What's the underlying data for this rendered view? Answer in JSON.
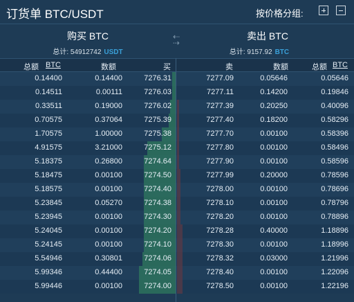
{
  "header": {
    "title": "订货单 BTC/USDT",
    "group_label": "按价格分组:",
    "plus_icon": "plus-icon",
    "minus_icon": "minus-icon"
  },
  "buy": {
    "title": "购买 BTC",
    "total_label": "总计: 54912742",
    "total_currency": "USDT"
  },
  "sell": {
    "title": "卖出 BTC",
    "total_label": "总计: 9157.92",
    "total_currency": "BTC"
  },
  "swap_icon": "swap-arrows-icon",
  "columns": {
    "total": "总额",
    "total_unit": "BTC",
    "amount": "数额",
    "buy": "买",
    "sell": "卖"
  },
  "colors": {
    "background": "#1e3b55",
    "buy_depth": "#2f7a5e",
    "sell_depth": "#5a3a45",
    "accent": "#3aa0d8"
  },
  "rows": [
    {
      "buy_total": "0.14400",
      "buy_amount": "0.14400",
      "buy_price": "7276.31",
      "sell_price": "7277.09",
      "sell_amount": "0.05646",
      "sell_total": "0.05646",
      "buy_depth": 0.02,
      "sell_depth": 0.0
    },
    {
      "buy_total": "0.14511",
      "buy_amount": "0.00111",
      "buy_price": "7276.03",
      "sell_price": "7277.11",
      "sell_amount": "0.14200",
      "sell_total": "0.19846",
      "buy_depth": 0.02,
      "sell_depth": 0.0
    },
    {
      "buy_total": "0.33511",
      "buy_amount": "0.19000",
      "buy_price": "7276.02",
      "sell_price": "7277.39",
      "sell_amount": "0.20250",
      "sell_total": "0.40096",
      "buy_depth": 0.03,
      "sell_depth": 0.01
    },
    {
      "buy_total": "0.70575",
      "buy_amount": "0.37064",
      "buy_price": "7275.39",
      "sell_price": "7277.40",
      "sell_amount": "0.18200",
      "sell_total": "0.58296",
      "buy_depth": 0.04,
      "sell_depth": 0.01
    },
    {
      "buy_total": "1.70575",
      "buy_amount": "1.00000",
      "buy_price": "7275.38",
      "sell_price": "7277.70",
      "sell_amount": "0.00100",
      "sell_total": "0.58396",
      "buy_depth": 0.08,
      "sell_depth": 0.01
    },
    {
      "buy_total": "4.91575",
      "buy_amount": "3.21000",
      "buy_price": "7275.12",
      "sell_price": "7277.80",
      "sell_amount": "0.00100",
      "sell_total": "0.58496",
      "buy_depth": 0.16,
      "sell_depth": 0.01
    },
    {
      "buy_total": "5.18375",
      "buy_amount": "0.26800",
      "buy_price": "7274.64",
      "sell_price": "7277.90",
      "sell_amount": "0.00100",
      "sell_total": "0.58596",
      "buy_depth": 0.18,
      "sell_depth": 0.01
    },
    {
      "buy_total": "5.18475",
      "buy_amount": "0.00100",
      "buy_price": "7274.50",
      "sell_price": "7277.99",
      "sell_amount": "0.20000",
      "sell_total": "0.78596",
      "buy_depth": 0.18,
      "sell_depth": 0.02
    },
    {
      "buy_total": "5.18575",
      "buy_amount": "0.00100",
      "buy_price": "7274.40",
      "sell_price": "7278.00",
      "sell_amount": "0.00100",
      "sell_total": "0.78696",
      "buy_depth": 0.18,
      "sell_depth": 0.02
    },
    {
      "buy_total": "5.23845",
      "buy_amount": "0.05270",
      "buy_price": "7274.38",
      "sell_price": "7278.10",
      "sell_amount": "0.00100",
      "sell_total": "0.78796",
      "buy_depth": 0.18,
      "sell_depth": 0.02
    },
    {
      "buy_total": "5.23945",
      "buy_amount": "0.00100",
      "buy_price": "7274.30",
      "sell_price": "7278.20",
      "sell_amount": "0.00100",
      "sell_total": "0.78896",
      "buy_depth": 0.18,
      "sell_depth": 0.02
    },
    {
      "buy_total": "5.24045",
      "buy_amount": "0.00100",
      "buy_price": "7274.20",
      "sell_price": "7278.28",
      "sell_amount": "0.40000",
      "sell_total": "1.18896",
      "buy_depth": 0.18,
      "sell_depth": 0.03
    },
    {
      "buy_total": "5.24145",
      "buy_amount": "0.00100",
      "buy_price": "7274.10",
      "sell_price": "7278.30",
      "sell_amount": "0.00100",
      "sell_total": "1.18996",
      "buy_depth": 0.18,
      "sell_depth": 0.03
    },
    {
      "buy_total": "5.54946",
      "buy_amount": "0.30801",
      "buy_price": "7274.06",
      "sell_price": "7278.32",
      "sell_amount": "0.03000",
      "sell_total": "1.21996",
      "buy_depth": 0.19,
      "sell_depth": 0.03
    },
    {
      "buy_total": "5.99346",
      "buy_amount": "0.44400",
      "buy_price": "7274.05",
      "sell_price": "7278.40",
      "sell_amount": "0.00100",
      "sell_total": "1.22096",
      "buy_depth": 0.21,
      "sell_depth": 0.03
    },
    {
      "buy_total": "5.99446",
      "buy_amount": "0.00100",
      "buy_price": "7274.00",
      "sell_price": "7278.50",
      "sell_amount": "0.00100",
      "sell_total": "1.22196",
      "buy_depth": 0.21,
      "sell_depth": 0.03
    }
  ]
}
